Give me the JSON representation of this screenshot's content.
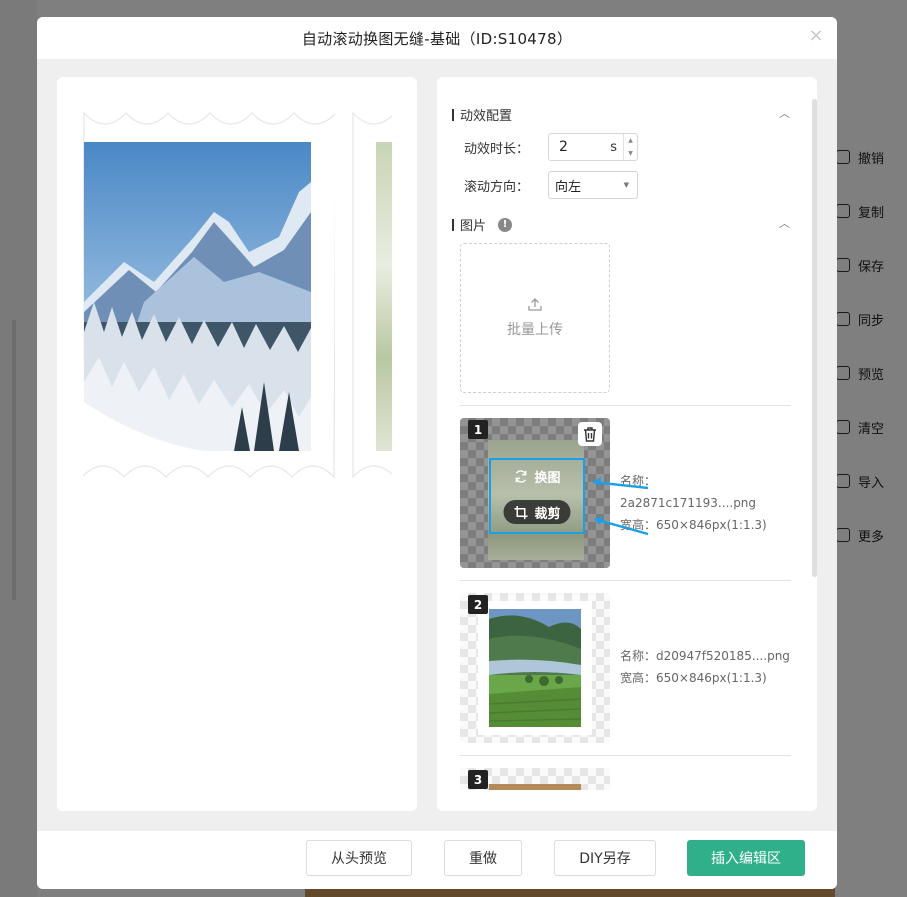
{
  "dialog": {
    "title": "自动滚动换图无缝-基础（ID:S10478）",
    "close_symbol": "×"
  },
  "right_toolbar": [
    {
      "label": "撤销",
      "icon": "undo-icon"
    },
    {
      "label": "复制",
      "icon": "copy-icon"
    },
    {
      "label": "保存",
      "icon": "save-icon"
    },
    {
      "label": "同步",
      "icon": "sync-icon"
    },
    {
      "label": "预览",
      "icon": "eye-icon"
    },
    {
      "label": "清空",
      "icon": "trash-icon"
    },
    {
      "label": "导入",
      "icon": "import-icon"
    },
    {
      "label": "更多",
      "icon": "more-icon"
    }
  ],
  "animation": {
    "section_title": "动效配置",
    "duration_label": "动效时长：",
    "duration_value": "2",
    "duration_unit": "s",
    "direction_label": "滚动方向：",
    "direction_value": "向左"
  },
  "images": {
    "section_title": "图片",
    "info_symbol": "!",
    "upload_label": "批量上传",
    "items": [
      {
        "index": "1",
        "name": "名称：2a2871c171193....png",
        "size": "宽高：650×846px(1:1.3)",
        "replace_label": "换图",
        "crop_label": "裁剪"
      },
      {
        "index": "2",
        "name": "名称：d20947f520185....png",
        "size": "宽高：650×846px(1:1.3)"
      },
      {
        "index": "3"
      }
    ]
  },
  "footer": {
    "preview_from_start": "从头预览",
    "redo": "重做",
    "diy_save_as": "DIY另存",
    "insert_editor": "插入编辑区"
  },
  "colors": {
    "primary": "#2fb08a",
    "highlight": "#1aa0e6"
  }
}
